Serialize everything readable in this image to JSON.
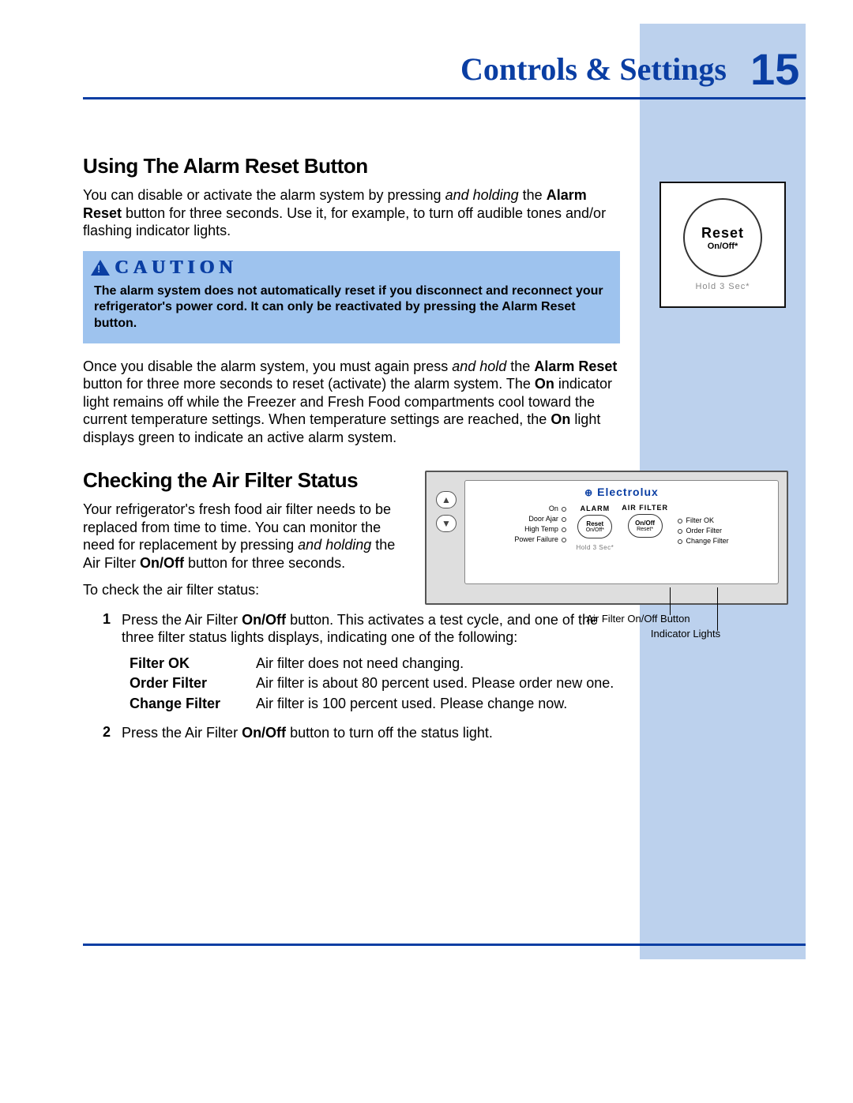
{
  "header": {
    "title": "Controls & Settings",
    "page_number": "15"
  },
  "colors": {
    "brand_blue": "#0a3ea3",
    "band_blue": "#bcd1ed",
    "caution_blue": "#9ec3ee"
  },
  "reset_figure": {
    "label_main": "Reset",
    "label_sub": "On/Off*",
    "hold_text": "Hold 3 Sec*"
  },
  "section1": {
    "heading": "Using The Alarm Reset Button",
    "para1_a": "You can disable or activate the alarm system by pressing ",
    "para1_em": "and holding",
    "para1_b": " the ",
    "para1_bold": "Alarm Reset",
    "para1_c": " button for three seconds. Use it, for example, to turn off audible tones and/or flashing indicator lights.",
    "caution_label": "CAUTION",
    "caution_body": "The alarm system does not automatically reset if you disconnect and reconnect your refrigerator's power cord. It can only be reactivated by pressing the Alarm Reset button.",
    "para2_a": "Once you disable the alarm system, you must again press ",
    "para2_em": "and hold",
    "para2_b": " the ",
    "para2_bold": "Alarm Reset",
    "para2_c": " button for three more seconds to reset (activate) the alarm system. The ",
    "para2_bold2": "On",
    "para2_d": " indicator light remains off while the Freezer and Fresh Food compartments cool toward the current temperature settings. When temperature settings are reached, the ",
    "para2_bold3": "On",
    "para2_e": " light displays green to indicate an active alarm system."
  },
  "section2": {
    "heading": "Checking the Air Filter Status",
    "para1_a": "Your refrigerator's fresh food air filter needs to be replaced from time to time. You can monitor the need for replacement by pressing ",
    "para1_em": "and holding",
    "para1_b": " the Air Filter ",
    "para1_bold": "On/Off",
    "para1_c": " button for three seconds.",
    "lead": "To check the air filter status:",
    "step1_a": "Press the Air Filter ",
    "step1_bold": "On/Off",
    "step1_b": " button. This activates a test cycle, and one of the three filter status lights displays, indicating one of the following:",
    "table": {
      "k1": "Filter OK",
      "v1": "Air filter does not need changing.",
      "k2": "Order Filter",
      "v2": "Air filter is about 80 percent used. Please order new one.",
      "k3": "Change Filter",
      "v3": "Air filter is 100 percent used. Please change now."
    },
    "step2_a": "Press the Air Filter ",
    "step2_bold": "On/Off",
    "step2_b": " button to turn off the status light."
  },
  "panel": {
    "brand": "Electrolux",
    "alarm_header": "ALARM",
    "filter_header": "AIR FILTER",
    "on": "On",
    "door_ajar": "Door Ajar",
    "high_temp": "High Temp",
    "power_failure": "Power Failure",
    "reset_main": "Reset",
    "reset_sub": "On/Off*",
    "filter_btn_main": "On/Off",
    "filter_btn_sub": "Reset*",
    "filter_ok": "Filter OK",
    "order_filter": "Order Filter",
    "change_filter": "Change Filter",
    "hold": "Hold 3 Sec*",
    "callout1": "Air Filter On/Off Button",
    "callout2": "Indicator Lights"
  }
}
